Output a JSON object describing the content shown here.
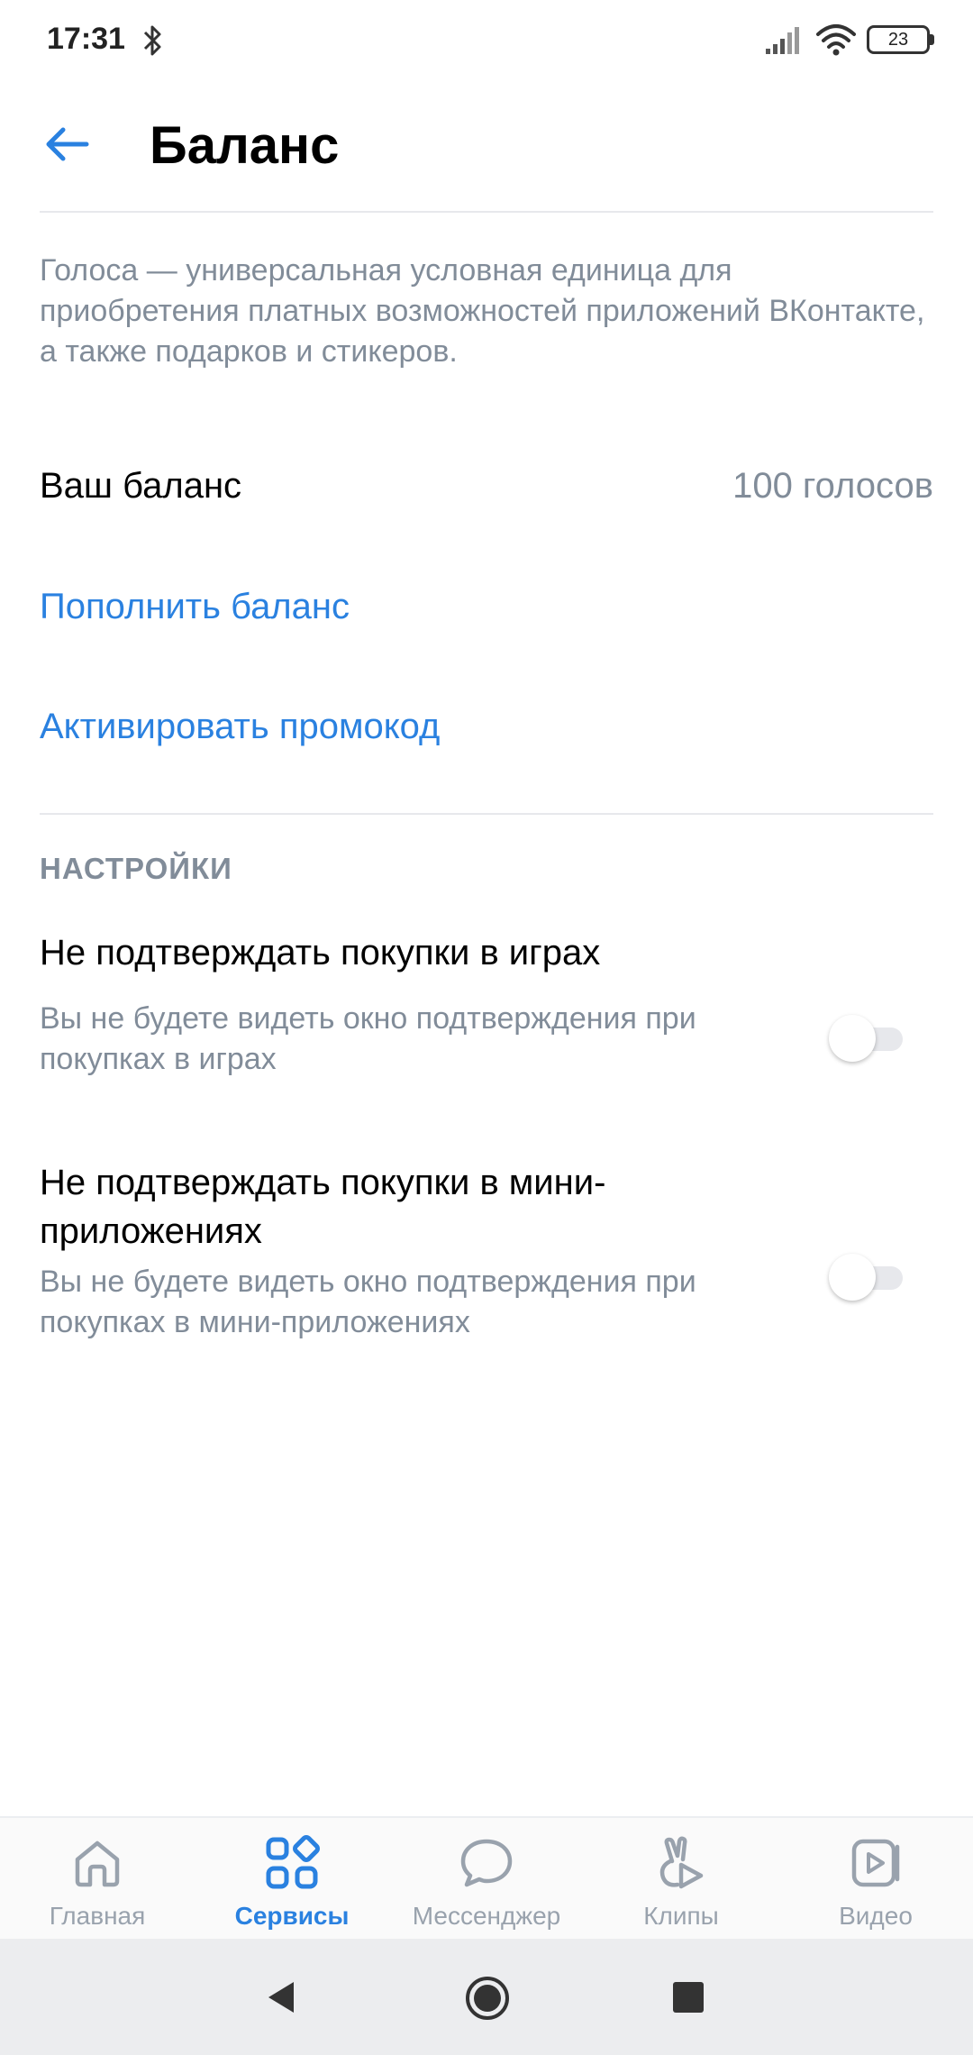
{
  "status": {
    "time": "17:31",
    "battery": "23"
  },
  "header": {
    "title": "Баланс"
  },
  "intro": "Голоса — универсальная условная единица для приобретения платных возможностей приложений ВКонтакте, а также подарков и стикеров.",
  "balance": {
    "label": "Ваш баланс",
    "value": "100 голосов"
  },
  "actions": {
    "top_up": "Пополнить баланс",
    "promo": "Активировать промокод"
  },
  "settings": {
    "section_title": "НАСТРОЙКИ",
    "items": [
      {
        "title": "Не подтверждать покупки в играх",
        "subtitle": "Вы не будете видеть окно подтверждения при покупках в играх",
        "enabled": false
      },
      {
        "title": "Не подтверждать покупки в мини-приложениях",
        "subtitle": "Вы не будете видеть окно подтверждения при покупках в мини-приложениях",
        "enabled": false
      }
    ]
  },
  "tabbar": {
    "items": [
      {
        "label": "Главная",
        "icon": "home-icon"
      },
      {
        "label": "Сервисы",
        "icon": "services-icon",
        "active": true
      },
      {
        "label": "Мессенджер",
        "icon": "message-icon"
      },
      {
        "label": "Клипы",
        "icon": "clips-icon"
      },
      {
        "label": "Видео",
        "icon": "video-icon"
      }
    ]
  },
  "colors": {
    "accent": "#2a81e0",
    "secondary_text": "#818c99",
    "inactive_tab": "#99a2ad"
  }
}
